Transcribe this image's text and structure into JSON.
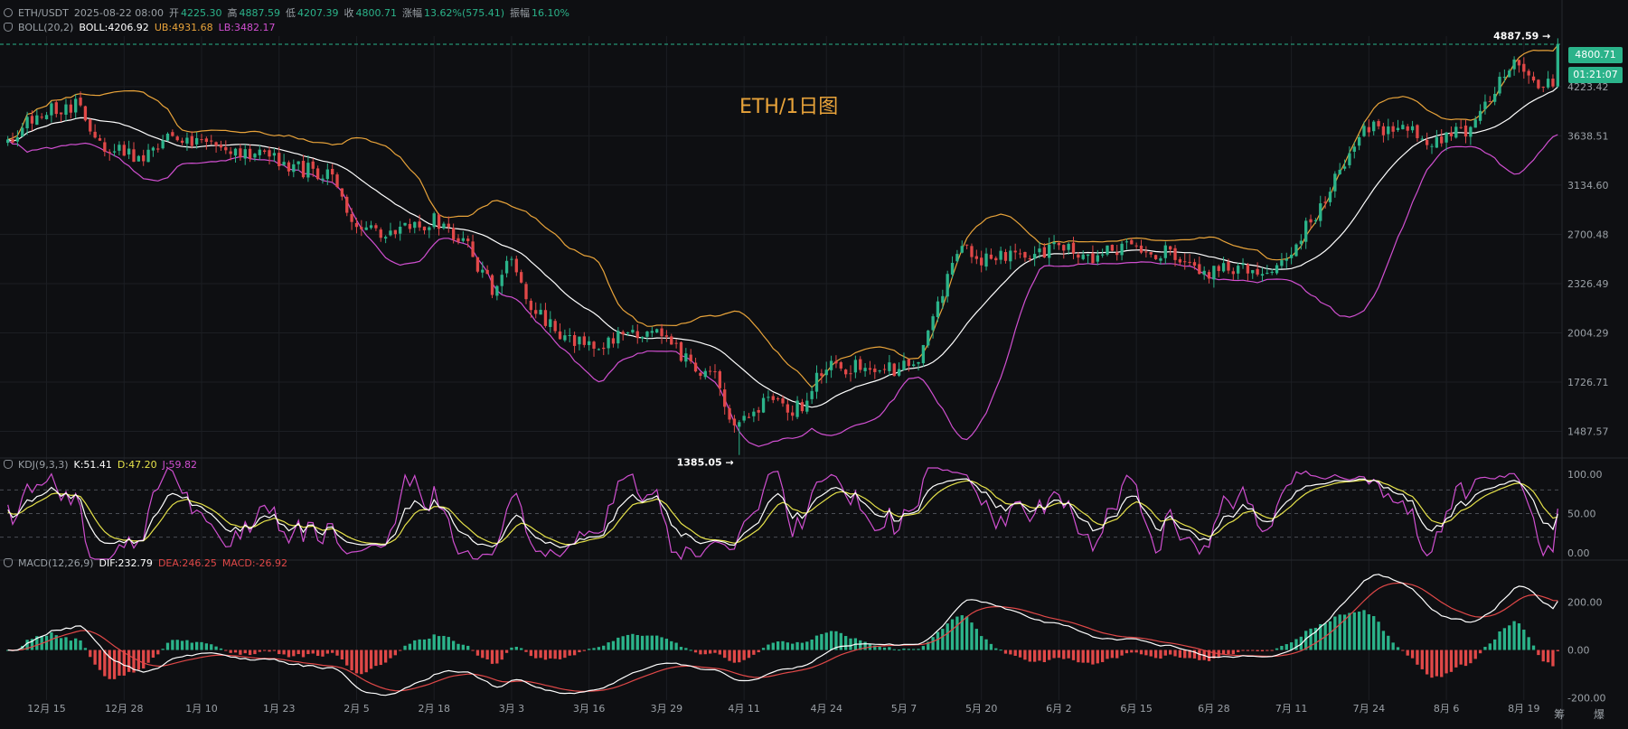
{
  "header": {
    "symbol": "ETH/USDT",
    "datetime": "2025-08-22 08:00",
    "open_label": "开",
    "open": "4225.30",
    "high_label": "高",
    "high": "4887.59",
    "low_label": "低",
    "low": "4207.39",
    "close_label": "收",
    "close": "4800.71",
    "change_label": "涨幅",
    "change": "13.62%(575.41)",
    "amp_label": "振幅",
    "amplitude": "16.10%"
  },
  "boll": {
    "name": "BOLL(20,2)",
    "mid": "BOLL:4206.92",
    "ub": "UB:4931.68",
    "lb": "LB:3482.17",
    "colors": {
      "mid": "#ffffff",
      "ub": "#e8a33a",
      "lb": "#d04fd0"
    }
  },
  "kdj": {
    "name": "KDJ(9,3,3)",
    "k": "K:51.41",
    "d": "D:47.20",
    "j": "J:59.82",
    "colors": {
      "k": "#ffffff",
      "d": "#e6e24a",
      "j": "#d04fd0"
    },
    "ticks": [
      "100.00",
      "50.00",
      "0.00"
    ]
  },
  "macd": {
    "name": "MACD(12,26,9)",
    "dif": "DIF:232.79",
    "dea": "DEA:246.25",
    "macd": "MACD:-26.92",
    "colors": {
      "dif": "#ffffff",
      "dea": "#e04848"
    },
    "ticks": [
      "200.00",
      "0.00",
      "-200.00"
    ]
  },
  "watermark": "ETH/1日图",
  "annotations": {
    "high": "4887.59",
    "low": "1385.05"
  },
  "last_price": {
    "value": "4800.71",
    "countdown": "01:21:07",
    "color": "#2bb38a"
  },
  "corner_label": "筹 爆",
  "colors": {
    "up": "#2bb38a",
    "down": "#e04848",
    "background": "#0e0f12",
    "grid": "#1c1e23"
  },
  "chart_data": [
    {
      "type": "candlestick",
      "title": "ETH/1日图",
      "x_ticks": [
        "12月 15",
        "12月 28",
        "1月 10",
        "1月 23",
        "2月 5",
        "2月 18",
        "3月 3",
        "3月 16",
        "3月 29",
        "4月 11",
        "4月 24",
        "5月 7",
        "5月 20",
        "6月 2",
        "6月 15",
        "6月 28",
        "7月 11",
        "7月 24",
        "8月 6",
        "8月 19"
      ],
      "y_ticks": [
        4223.42,
        3638.51,
        3134.6,
        2700.48,
        2326.49,
        2004.29,
        1726.71,
        1487.57
      ],
      "y_range": [
        1380,
        4920
      ],
      "y_scale": "log",
      "grid": true,
      "indicators": [
        "BOLL(20,2)"
      ],
      "close_anchors": [
        [
          0,
          3600
        ],
        [
          8,
          3950
        ],
        [
          14,
          3980
        ],
        [
          20,
          3550
        ],
        [
          26,
          3400
        ],
        [
          36,
          3650
        ],
        [
          44,
          3500
        ],
        [
          52,
          3420
        ],
        [
          60,
          3300
        ],
        [
          66,
          3250
        ],
        [
          72,
          2800
        ],
        [
          80,
          2700
        ],
        [
          88,
          2820
        ],
        [
          94,
          2650
        ],
        [
          100,
          2300
        ],
        [
          104,
          2500
        ],
        [
          108,
          2150
        ],
        [
          114,
          2000
        ],
        [
          120,
          1920
        ],
        [
          128,
          2000
        ],
        [
          134,
          2050
        ],
        [
          140,
          1850
        ],
        [
          146,
          1750
        ],
        [
          150,
          1500
        ],
        [
          156,
          1620
        ],
        [
          164,
          1590
        ],
        [
          168,
          1800
        ],
        [
          176,
          1810
        ],
        [
          184,
          1800
        ],
        [
          188,
          1850
        ],
        [
          196,
          2580
        ],
        [
          202,
          2500
        ],
        [
          210,
          2550
        ],
        [
          218,
          2600
        ],
        [
          224,
          2520
        ],
        [
          232,
          2600
        ],
        [
          240,
          2550
        ],
        [
          246,
          2380
        ],
        [
          252,
          2450
        ],
        [
          258,
          2420
        ],
        [
          264,
          2520
        ],
        [
          272,
          3000
        ],
        [
          280,
          3750
        ],
        [
          288,
          3700
        ],
        [
          294,
          3600
        ],
        [
          302,
          3680
        ],
        [
          308,
          4300
        ],
        [
          312,
          4550
        ],
        [
          316,
          4300
        ],
        [
          319,
          4225
        ],
        [
          320,
          4800
        ]
      ],
      "last": {
        "date": "2025-08-22",
        "open": 4225.3,
        "high": 4887.59,
        "low": 4207.39,
        "close": 4800.71
      },
      "marked_high": 4887.59,
      "marked_low": 1385.05
    },
    {
      "type": "line",
      "indicator": "KDJ(9,3,3)",
      "y_range": [
        0,
        100
      ],
      "guide_lines": [
        80,
        50,
        20
      ],
      "series": [
        {
          "name": "K",
          "last": 51.41
        },
        {
          "name": "D",
          "last": 47.2
        },
        {
          "name": "J",
          "last": 59.82
        }
      ]
    },
    {
      "type": "histogram+line",
      "indicator": "MACD(12,26,9)",
      "y_range": [
        -210,
        320
      ],
      "series": [
        {
          "name": "DIF",
          "last": 232.79
        },
        {
          "name": "DEA",
          "last": 246.25
        },
        {
          "name": "MACD",
          "last": -26.92
        }
      ]
    }
  ]
}
